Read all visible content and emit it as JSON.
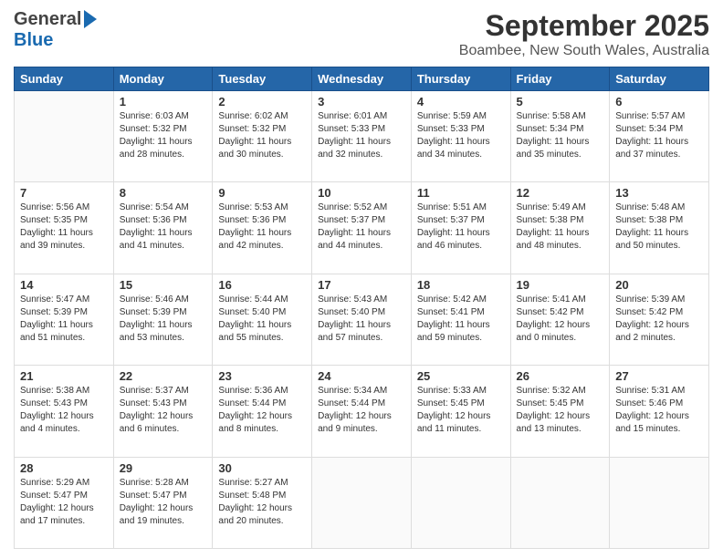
{
  "header": {
    "logo_general": "General",
    "logo_blue": "Blue",
    "month_title": "September 2025",
    "location": "Boambee, New South Wales, Australia"
  },
  "weekdays": [
    "Sunday",
    "Monday",
    "Tuesday",
    "Wednesday",
    "Thursday",
    "Friday",
    "Saturday"
  ],
  "weeks": [
    [
      {
        "day": "",
        "info": ""
      },
      {
        "day": "1",
        "info": "Sunrise: 6:03 AM\nSunset: 5:32 PM\nDaylight: 11 hours\nand 28 minutes."
      },
      {
        "day": "2",
        "info": "Sunrise: 6:02 AM\nSunset: 5:32 PM\nDaylight: 11 hours\nand 30 minutes."
      },
      {
        "day": "3",
        "info": "Sunrise: 6:01 AM\nSunset: 5:33 PM\nDaylight: 11 hours\nand 32 minutes."
      },
      {
        "day": "4",
        "info": "Sunrise: 5:59 AM\nSunset: 5:33 PM\nDaylight: 11 hours\nand 34 minutes."
      },
      {
        "day": "5",
        "info": "Sunrise: 5:58 AM\nSunset: 5:34 PM\nDaylight: 11 hours\nand 35 minutes."
      },
      {
        "day": "6",
        "info": "Sunrise: 5:57 AM\nSunset: 5:34 PM\nDaylight: 11 hours\nand 37 minutes."
      }
    ],
    [
      {
        "day": "7",
        "info": "Sunrise: 5:56 AM\nSunset: 5:35 PM\nDaylight: 11 hours\nand 39 minutes."
      },
      {
        "day": "8",
        "info": "Sunrise: 5:54 AM\nSunset: 5:36 PM\nDaylight: 11 hours\nand 41 minutes."
      },
      {
        "day": "9",
        "info": "Sunrise: 5:53 AM\nSunset: 5:36 PM\nDaylight: 11 hours\nand 42 minutes."
      },
      {
        "day": "10",
        "info": "Sunrise: 5:52 AM\nSunset: 5:37 PM\nDaylight: 11 hours\nand 44 minutes."
      },
      {
        "day": "11",
        "info": "Sunrise: 5:51 AM\nSunset: 5:37 PM\nDaylight: 11 hours\nand 46 minutes."
      },
      {
        "day": "12",
        "info": "Sunrise: 5:49 AM\nSunset: 5:38 PM\nDaylight: 11 hours\nand 48 minutes."
      },
      {
        "day": "13",
        "info": "Sunrise: 5:48 AM\nSunset: 5:38 PM\nDaylight: 11 hours\nand 50 minutes."
      }
    ],
    [
      {
        "day": "14",
        "info": "Sunrise: 5:47 AM\nSunset: 5:39 PM\nDaylight: 11 hours\nand 51 minutes."
      },
      {
        "day": "15",
        "info": "Sunrise: 5:46 AM\nSunset: 5:39 PM\nDaylight: 11 hours\nand 53 minutes."
      },
      {
        "day": "16",
        "info": "Sunrise: 5:44 AM\nSunset: 5:40 PM\nDaylight: 11 hours\nand 55 minutes."
      },
      {
        "day": "17",
        "info": "Sunrise: 5:43 AM\nSunset: 5:40 PM\nDaylight: 11 hours\nand 57 minutes."
      },
      {
        "day": "18",
        "info": "Sunrise: 5:42 AM\nSunset: 5:41 PM\nDaylight: 11 hours\nand 59 minutes."
      },
      {
        "day": "19",
        "info": "Sunrise: 5:41 AM\nSunset: 5:42 PM\nDaylight: 12 hours\nand 0 minutes."
      },
      {
        "day": "20",
        "info": "Sunrise: 5:39 AM\nSunset: 5:42 PM\nDaylight: 12 hours\nand 2 minutes."
      }
    ],
    [
      {
        "day": "21",
        "info": "Sunrise: 5:38 AM\nSunset: 5:43 PM\nDaylight: 12 hours\nand 4 minutes."
      },
      {
        "day": "22",
        "info": "Sunrise: 5:37 AM\nSunset: 5:43 PM\nDaylight: 12 hours\nand 6 minutes."
      },
      {
        "day": "23",
        "info": "Sunrise: 5:36 AM\nSunset: 5:44 PM\nDaylight: 12 hours\nand 8 minutes."
      },
      {
        "day": "24",
        "info": "Sunrise: 5:34 AM\nSunset: 5:44 PM\nDaylight: 12 hours\nand 9 minutes."
      },
      {
        "day": "25",
        "info": "Sunrise: 5:33 AM\nSunset: 5:45 PM\nDaylight: 12 hours\nand 11 minutes."
      },
      {
        "day": "26",
        "info": "Sunrise: 5:32 AM\nSunset: 5:45 PM\nDaylight: 12 hours\nand 13 minutes."
      },
      {
        "day": "27",
        "info": "Sunrise: 5:31 AM\nSunset: 5:46 PM\nDaylight: 12 hours\nand 15 minutes."
      }
    ],
    [
      {
        "day": "28",
        "info": "Sunrise: 5:29 AM\nSunset: 5:47 PM\nDaylight: 12 hours\nand 17 minutes."
      },
      {
        "day": "29",
        "info": "Sunrise: 5:28 AM\nSunset: 5:47 PM\nDaylight: 12 hours\nand 19 minutes."
      },
      {
        "day": "30",
        "info": "Sunrise: 5:27 AM\nSunset: 5:48 PM\nDaylight: 12 hours\nand 20 minutes."
      },
      {
        "day": "",
        "info": ""
      },
      {
        "day": "",
        "info": ""
      },
      {
        "day": "",
        "info": ""
      },
      {
        "day": "",
        "info": ""
      }
    ]
  ]
}
